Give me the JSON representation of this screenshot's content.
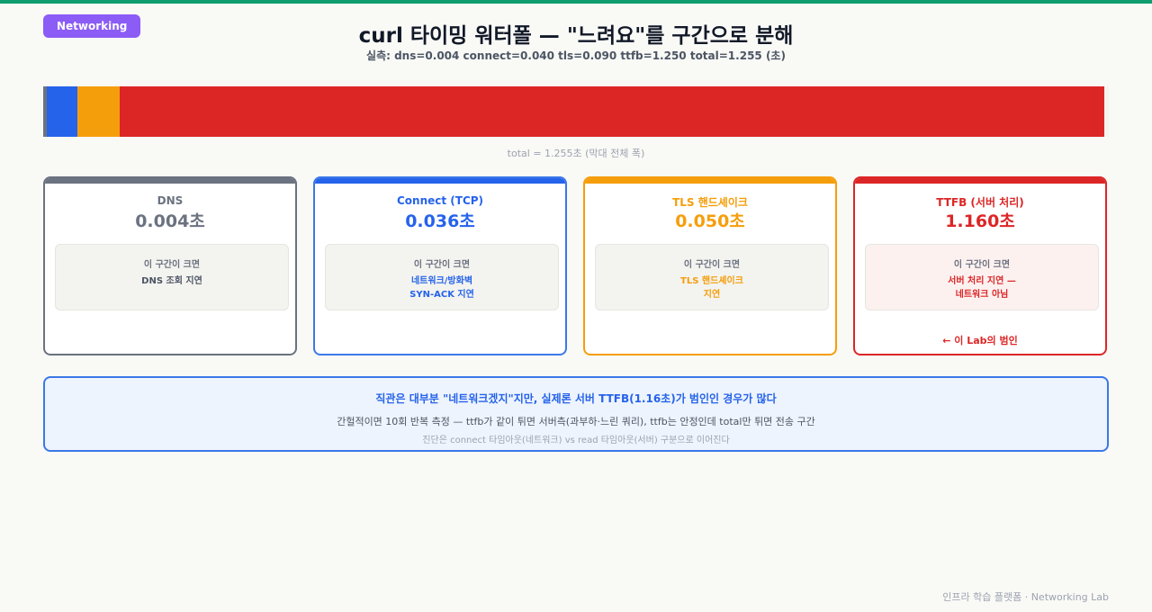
{
  "badge": "Networking",
  "title": "curl 타이밍 워터폴 — \"느려요\"를 구간으로 분해",
  "subtitle": "실측: dns=0.004 connect=0.040 tls=0.090 ttfb=1.250 total=1.255 (초)",
  "bar_caption": "total = 1.255초 (막대 전체 폭)",
  "chart_data": {
    "type": "bar",
    "orientation": "horizontal-stacked",
    "total": 1.255,
    "segments": [
      {
        "name": "DNS",
        "value": 0.004,
        "color": "#6b7280"
      },
      {
        "name": "Connect (TCP)",
        "value": 0.036,
        "color": "#2563eb"
      },
      {
        "name": "TLS 핸드셰이크",
        "value": 0.05,
        "color": "#f59e0b"
      },
      {
        "name": "TTFB (서버 처리)",
        "value": 1.16,
        "color": "#dc2626"
      }
    ]
  },
  "cards": [
    {
      "name": "DNS",
      "value": "0.004초",
      "hint": "이 구간이 크면",
      "meaning": "DNS 조회 지연",
      "color": "#6b7280",
      "border": "#6b7280",
      "box_bg": "#f3f3ef",
      "text_color": "#4b5563"
    },
    {
      "name": "Connect (TCP)",
      "value": "0.036초",
      "hint": "이 구간이 크면",
      "meaning": "네트워크/방화벽\nSYN-ACK 지연",
      "color": "#2563eb",
      "border": "#3b78e7",
      "box_bg": "#f3f3ef",
      "text_color": "#2563eb"
    },
    {
      "name": "TLS 핸드셰이크",
      "value": "0.050초",
      "hint": "이 구간이 크면",
      "meaning": "TLS 핸드셰이크\n지연",
      "color": "#f59e0b",
      "border": "#f59e0b",
      "box_bg": "#f3f3ef",
      "text_color": "#f59e0b"
    },
    {
      "name": "TTFB (서버 처리)",
      "value": "1.160초",
      "hint": "이 구간이 크면",
      "meaning": "서버 처리 지연 —\n네트워크 아님",
      "color": "#dc2626",
      "border": "#dc2626",
      "box_bg": "#fdf1f0",
      "text_color": "#dc2626",
      "culprit": "← 이 Lab의 범인"
    }
  ],
  "note": {
    "title": "직관은 대부분 \"네트워크겠지\"지만, 실제론 서버 TTFB(1.16초)가 범인인 경우가 많다",
    "line1": "간헐적이면 10회 반복 측정 — ttfb가 같이 튀면 서버측(과부하·느린 쿼리), ttfb는 안정인데 total만 튀면 전송 구간",
    "line2": "진단은 connect 타임아웃(네트워크) vs read 타임아웃(서버) 구분으로 이어진다"
  },
  "footer": "인프라 학습 플랫폼 · Networking Lab"
}
